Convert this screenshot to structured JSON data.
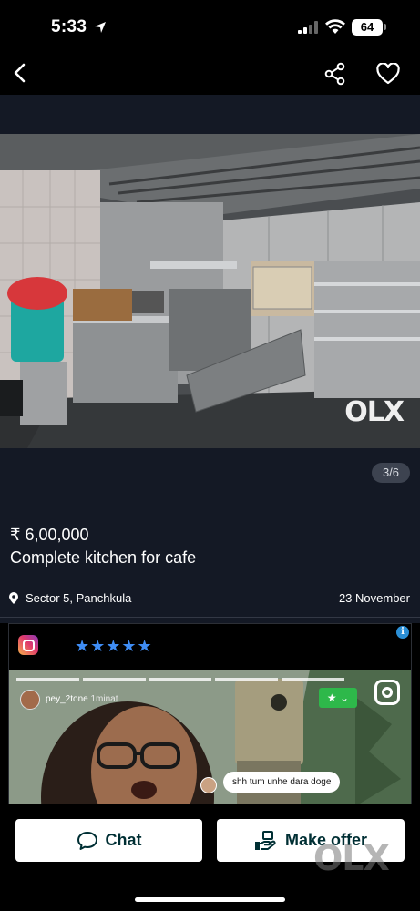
{
  "status_bar": {
    "time": "5:33",
    "battery": "64"
  },
  "nav": {
    "back_icon": "chevron-left-icon",
    "share_icon": "share-icon",
    "favorite_icon": "heart-icon"
  },
  "listing": {
    "photo_counter": "3/6",
    "watermark": "OLX",
    "price": "₹ 6,00,000",
    "title": "Complete kitchen for cafe",
    "location": "Sector 5, Panchkula",
    "date": "23 November"
  },
  "ad": {
    "info_icon": "i",
    "stars": "★★★★★",
    "username": "pey_2tone",
    "time_ago": "1minat",
    "comment": "shh tum unhe dara doge"
  },
  "actions": {
    "chat_label": "Chat",
    "offer_label": "Make offer"
  },
  "colors": {
    "background": "#141925",
    "button_bg": "#ffffff",
    "button_text": "#002f34",
    "star_blue": "#3f8df5"
  }
}
